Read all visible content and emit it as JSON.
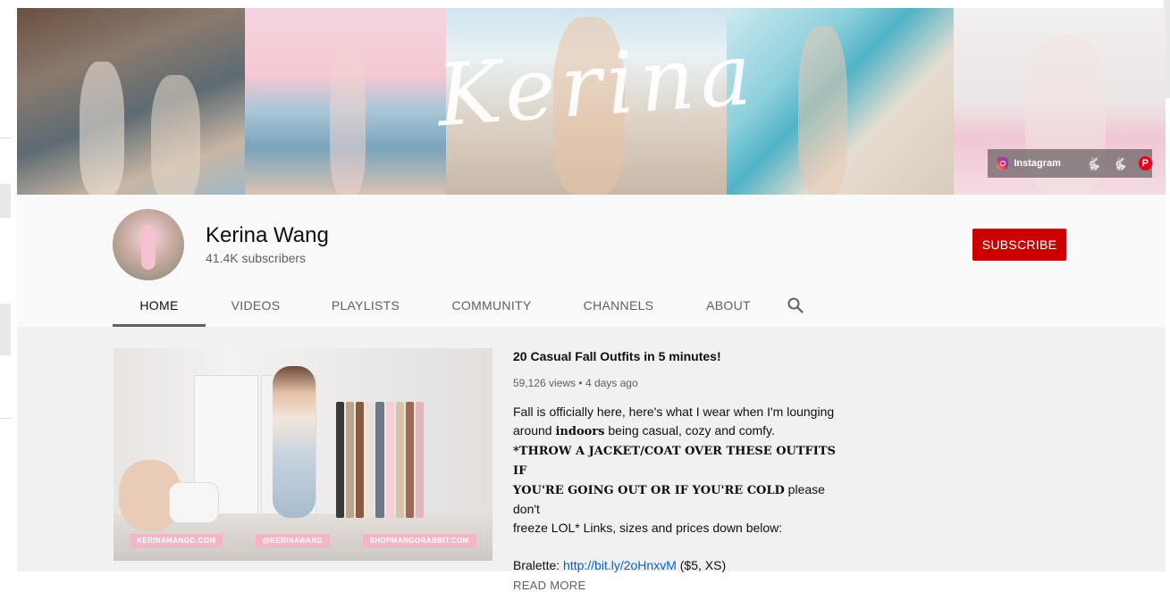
{
  "banner": {
    "script_logo": "Kerina",
    "social": {
      "instagram_label": "Instagram",
      "links": [
        "instagram-icon",
        "bunny-black-icon",
        "bunny-pink-icon",
        "pinterest-icon"
      ]
    }
  },
  "channel": {
    "name": "Kerina Wang",
    "subscribers": "41.4K subscribers",
    "subscribe_label": "SUBSCRIBE",
    "accent_color": "#cc0000"
  },
  "tabs": [
    {
      "label": "HOME",
      "active": true
    },
    {
      "label": "VIDEOS",
      "active": false
    },
    {
      "label": "PLAYLISTS",
      "active": false
    },
    {
      "label": "COMMUNITY",
      "active": false
    },
    {
      "label": "CHANNELS",
      "active": false
    },
    {
      "label": "ABOUT",
      "active": false
    }
  ],
  "featured_video": {
    "thumbnail_tags": [
      "KERINAMANGO.COM",
      "@KERINAWANG",
      "SHOPMANGORABBIT.COM"
    ],
    "title": "20 Casual Fall Outfits in 5 minutes!",
    "views": "59,126 views",
    "age": "4 days ago",
    "separator": "•",
    "desc_line1": "Fall is officially here, here's what I wear when I'm lounging",
    "desc_line2_pre": "around ",
    "desc_line2_bold": "indoors",
    "desc_line2_post": " being casual, cozy and comfy.",
    "desc_line3_bold": "*THROW A JACKET/COAT OVER THESE OUTFITS IF",
    "desc_line4_bold": "YOU'RE GOING OUT OR IF YOU'RE COLD",
    "desc_line4_post": " please don't",
    "desc_line5": "freeze LOL*  Links, sizes and prices down below:",
    "bralette_label": "Bralette: ",
    "bralette_link": "http://bit.ly/2oHnxvM",
    "bralette_note": " ($5, XS)",
    "read_more": "READ MORE"
  }
}
